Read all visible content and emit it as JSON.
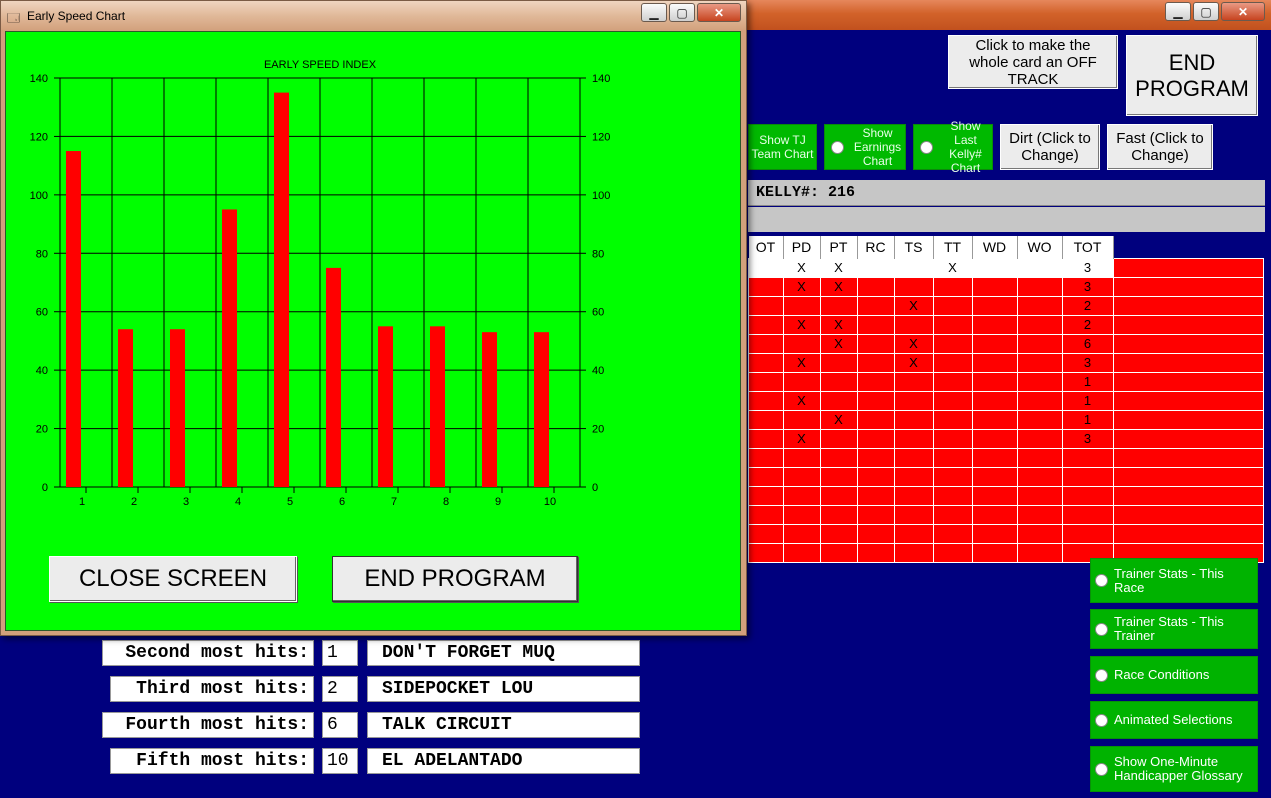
{
  "main_window": {
    "buttons": {
      "off_track": "Click to make the whole card an OFF TRACK",
      "end_program": "END PROGRAM",
      "dirt": "Dirt (Click to Change)",
      "fast": "Fast (Click to Change)"
    },
    "options": {
      "tj_team": "Show TJ Team Chart",
      "earnings": "Show Earnings Chart",
      "kelly": "Show Last Kelly# Chart"
    },
    "kelly_text": "KELLY#: 216",
    "grid": {
      "headers": [
        "OT",
        "PD",
        "PT",
        "RC",
        "TS",
        "TT",
        "WD",
        "WO",
        "TOT"
      ],
      "rows": [
        [
          "",
          "X",
          "X",
          "",
          "",
          "X",
          "",
          "",
          "3"
        ],
        [
          "",
          "X",
          "X",
          "",
          "",
          "",
          "",
          "",
          "3"
        ],
        [
          "",
          "",
          "",
          "",
          "X",
          "",
          "",
          "",
          "2"
        ],
        [
          "",
          "X",
          "X",
          "",
          "",
          "",
          "",
          "",
          "2"
        ],
        [
          "",
          "",
          "X",
          "",
          "X",
          "",
          "",
          "",
          "6"
        ],
        [
          "",
          "X",
          "",
          "",
          "X",
          "",
          "",
          "",
          "3"
        ],
        [
          "",
          "",
          "",
          "",
          "",
          "",
          "",
          "",
          "1"
        ],
        [
          "",
          "X",
          "",
          "",
          "",
          "",
          "",
          "",
          "1"
        ],
        [
          "",
          "",
          "X",
          "",
          "",
          "",
          "",
          "",
          "1"
        ],
        [
          "",
          "X",
          "",
          "",
          "",
          "",
          "",
          "",
          "3"
        ],
        [
          "",
          "",
          "",
          "",
          "",
          "",
          "",
          "",
          ""
        ],
        [
          "",
          "",
          "",
          "",
          "",
          "",
          "",
          "",
          ""
        ],
        [
          "",
          "",
          "",
          "",
          "",
          "",
          "",
          "",
          ""
        ],
        [
          "",
          "",
          "",
          "",
          "",
          "",
          "",
          "",
          ""
        ],
        [
          "",
          "",
          "",
          "",
          "",
          "",
          "",
          "",
          ""
        ],
        [
          "",
          "",
          "",
          "",
          "",
          "",
          "",
          "",
          ""
        ]
      ]
    },
    "side_buttons": [
      "Trainer Stats - This Race",
      "Trainer Stats - This Trainer",
      "Race Conditions",
      "Animated Selections",
      "Show One-Minute Handicapper Glossary"
    ],
    "hits": [
      {
        "label": "Second most hits:",
        "num": "1",
        "name": "DON'T FORGET MUQ"
      },
      {
        "label": "Third most hits:",
        "num": "2",
        "name": "SIDEPOCKET LOU"
      },
      {
        "label": "Fourth most hits:",
        "num": "6",
        "name": "TALK CIRCUIT"
      },
      {
        "label": "Fifth most hits:",
        "num": "10",
        "name": "EL ADELANTADO"
      }
    ]
  },
  "chart_window": {
    "title": "Early Speed Chart",
    "close_button": "CLOSE SCREEN",
    "end_button": "END PROGRAM"
  },
  "chart_data": {
    "type": "bar",
    "title": "EARLY SPEED INDEX",
    "categories": [
      "1",
      "2",
      "3",
      "4",
      "5",
      "6",
      "7",
      "8",
      "9",
      "10"
    ],
    "values": [
      115,
      54,
      54,
      95,
      135,
      75,
      55,
      55,
      53,
      53
    ],
    "ylim": [
      0,
      140
    ],
    "yticks": [
      0,
      20,
      40,
      60,
      80,
      100,
      120,
      140
    ],
    "grid": true,
    "colors": {
      "bar": "#ff0000",
      "background": "#00ff00",
      "grid": "#000000"
    }
  }
}
